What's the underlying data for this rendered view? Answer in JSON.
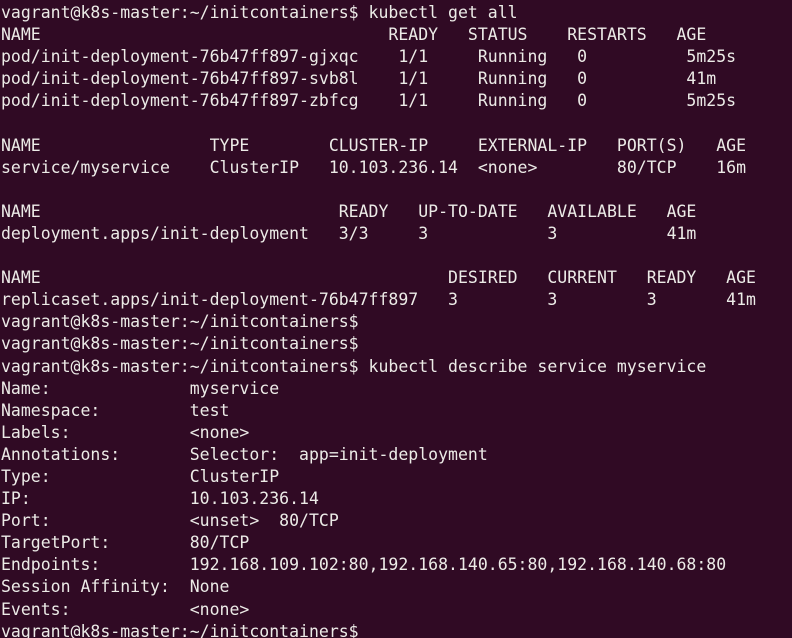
{
  "terminal": {
    "window_kind": "ubuntu-gnome-terminal",
    "colors": {
      "background": "#300a24",
      "foreground": "#ecebe7"
    },
    "prompt": "vagrant@k8s-master:~/initcontainers$",
    "user": "vagrant",
    "host": "k8s-master",
    "cwd": "~/initcontainers",
    "lines": [
      "vagrant@k8s-master:~/initcontainers$ kubectl get all",
      "NAME                                   READY   STATUS    RESTARTS   AGE",
      "pod/init-deployment-76b47ff897-gjxqc    1/1     Running   0          5m25s",
      "pod/init-deployment-76b47ff897-svb8l    1/1     Running   0          41m",
      "pod/init-deployment-76b47ff897-zbfcg    1/1     Running   0          5m25s",
      "",
      "NAME                 TYPE        CLUSTER-IP     EXTERNAL-IP   PORT(S)   AGE",
      "service/myservice    ClusterIP   10.103.236.14  <none>        80/TCP    16m",
      "",
      "NAME                              READY   UP-TO-DATE   AVAILABLE   AGE",
      "deployment.apps/init-deployment   3/3     3            3           41m",
      "",
      "NAME                                         DESIRED   CURRENT   READY   AGE",
      "replicaset.apps/init-deployment-76b47ff897   3         3         3       41m",
      "vagrant@k8s-master:~/initcontainers$",
      "vagrant@k8s-master:~/initcontainers$",
      "vagrant@k8s-master:~/initcontainers$ kubectl describe service myservice",
      "Name:              myservice",
      "Namespace:         test",
      "Labels:            <none>",
      "Annotations:       Selector:  app=init-deployment",
      "Type:              ClusterIP",
      "IP:                10.103.236.14",
      "Port:              <unset>  80/TCP",
      "TargetPort:        80/TCP",
      "Endpoints:         192.168.109.102:80,192.168.140.65:80,192.168.140.68:80",
      "Session Affinity:  None",
      "Events:            <none>",
      "vagrant@k8s-master:~/initcontainers$"
    ],
    "commands": [
      "kubectl get all",
      "kubectl describe service myservice"
    ],
    "get_all": {
      "pods": {
        "headers": [
          "NAME",
          "READY",
          "STATUS",
          "RESTARTS",
          "AGE"
        ],
        "rows": [
          [
            "pod/init-deployment-76b47ff897-gjxqc",
            "1/1",
            "Running",
            "0",
            "5m25s"
          ],
          [
            "pod/init-deployment-76b47ff897-svb8l",
            "1/1",
            "Running",
            "0",
            "41m"
          ],
          [
            "pod/init-deployment-76b47ff897-zbfcg",
            "1/1",
            "Running",
            "0",
            "5m25s"
          ]
        ]
      },
      "services": {
        "headers": [
          "NAME",
          "TYPE",
          "CLUSTER-IP",
          "EXTERNAL-IP",
          "PORT(S)",
          "AGE"
        ],
        "rows": [
          [
            "service/myservice",
            "ClusterIP",
            "10.103.236.14",
            "<none>",
            "80/TCP",
            "16m"
          ]
        ]
      },
      "deployments": {
        "headers": [
          "NAME",
          "READY",
          "UP-TO-DATE",
          "AVAILABLE",
          "AGE"
        ],
        "rows": [
          [
            "deployment.apps/init-deployment",
            "3/3",
            "3",
            "3",
            "41m"
          ]
        ]
      },
      "replicasets": {
        "headers": [
          "NAME",
          "DESIRED",
          "CURRENT",
          "READY",
          "AGE"
        ],
        "rows": [
          [
            "replicaset.apps/init-deployment-76b47ff897",
            "3",
            "3",
            "3",
            "41m"
          ]
        ]
      }
    },
    "describe_service": {
      "fields": [
        {
          "label": "Name:",
          "value": "myservice"
        },
        {
          "label": "Namespace:",
          "value": "test"
        },
        {
          "label": "Labels:",
          "value": "<none>"
        },
        {
          "label": "Annotations:",
          "value": "Selector:  app=init-deployment"
        },
        {
          "label": "Type:",
          "value": "ClusterIP"
        },
        {
          "label": "IP:",
          "value": "10.103.236.14"
        },
        {
          "label": "Port:",
          "value": "<unset>  80/TCP"
        },
        {
          "label": "TargetPort:",
          "value": "80/TCP"
        },
        {
          "label": "Endpoints:",
          "value": "192.168.109.102:80,192.168.140.65:80,192.168.140.68:80"
        },
        {
          "label": "Session Affinity:",
          "value": "None"
        },
        {
          "label": "Events:",
          "value": "<none>"
        }
      ]
    }
  }
}
